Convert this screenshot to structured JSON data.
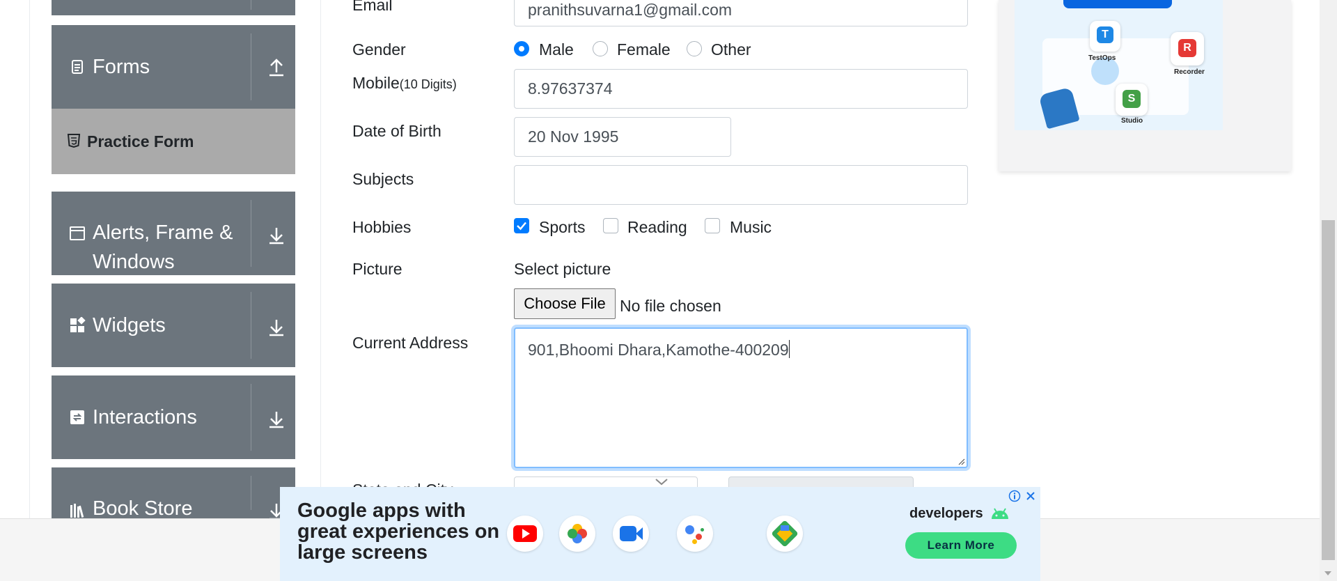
{
  "sidebar": {
    "groups": [
      {
        "label": "Forms"
      },
      {
        "label_line1": "Alerts, Frame &",
        "label_line2": "Windows"
      },
      {
        "label": "Widgets"
      },
      {
        "label": "Interactions"
      },
      {
        "label": "Book Store"
      }
    ],
    "active_item": "Practice Form"
  },
  "form": {
    "email_label": "Email",
    "email_value": "pranithsuvarna1@gmail.com",
    "gender_label": "Gender",
    "gender_options": [
      "Male",
      "Female",
      "Other"
    ],
    "gender_selected": "Male",
    "mobile_label": "Mobile",
    "mobile_hint": "(10 Digits)",
    "mobile_value": "8.97637374",
    "dob_label": "Date of Birth",
    "dob_value": "20 Nov 1995",
    "subjects_label": "Subjects",
    "subjects_value": "",
    "hobbies_label": "Hobbies",
    "hobbies": [
      {
        "label": "Sports",
        "checked": true
      },
      {
        "label": "Reading",
        "checked": false
      },
      {
        "label": "Music",
        "checked": false
      }
    ],
    "picture_label": "Picture",
    "select_picture_label": "Select picture",
    "choose_file_label": "Choose File",
    "no_file_text": "No file chosen",
    "current_address_label": "Current Address",
    "current_address_value": "901,Bhoomi Dhara,Kamothe-400209",
    "state_city_label": "State and City"
  },
  "side_ad": {
    "badges": [
      "TestOps",
      "Recorder",
      "Studio"
    ]
  },
  "banner_ad": {
    "headline": "Google apps with great experiences on large screens",
    "brand": "developers",
    "cta": "Learn More",
    "apps": [
      "youtube-icon",
      "google-photos-icon",
      "google-meet-icon",
      "google-assistant-icon",
      "google-maps-icon"
    ]
  },
  "colors": {
    "sidebar_bg": "#6c757d",
    "active_bg": "#aaaaaa",
    "primary": "#007bff",
    "cta_green": "#3ddc84"
  }
}
